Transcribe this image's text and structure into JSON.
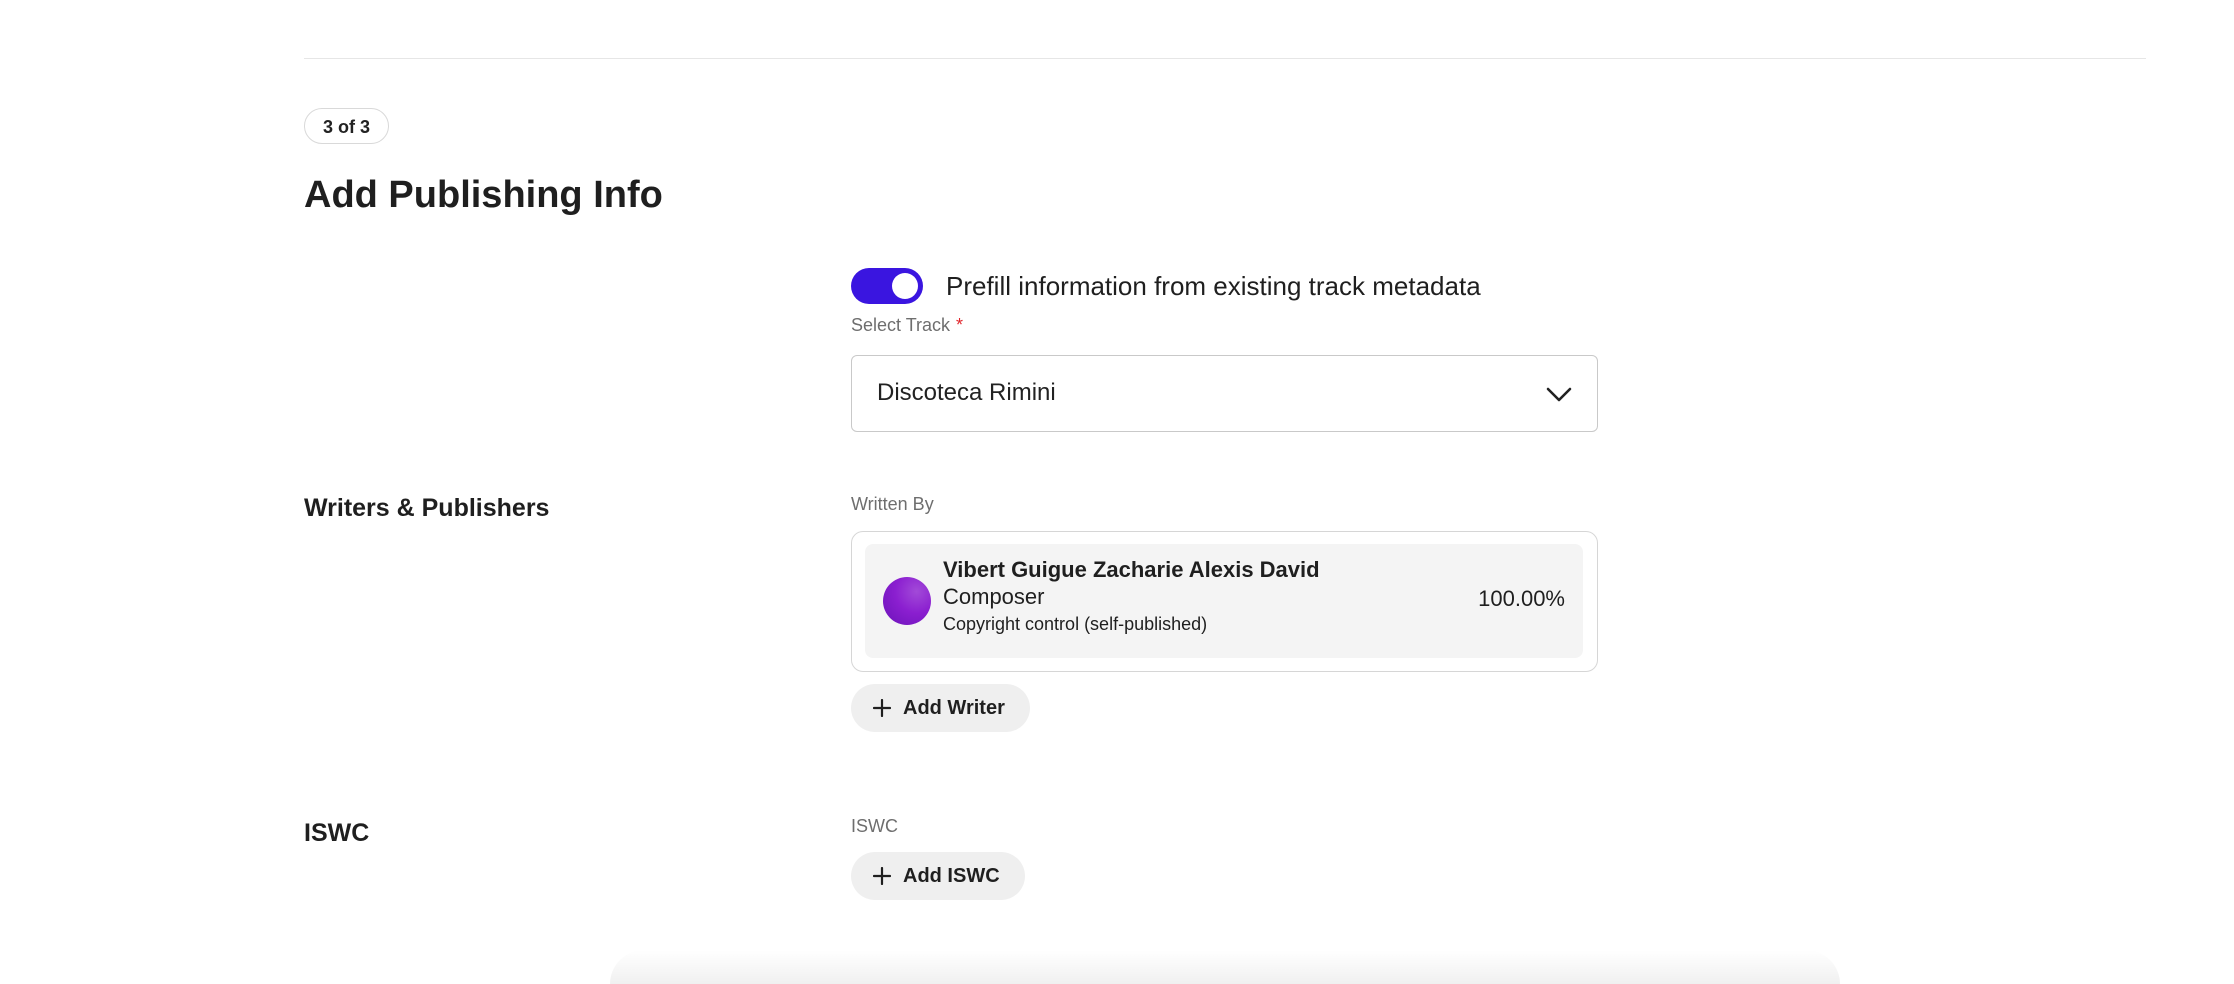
{
  "step_badge": "3 of 3",
  "page_title": "Add Publishing Info",
  "prefill": {
    "enabled": true,
    "label": "Prefill information from existing track metadata"
  },
  "select_track": {
    "label": "Select Track",
    "required_mark": "*",
    "value": "Discoteca Rimini"
  },
  "writers_section": {
    "heading": "Writers & Publishers",
    "written_by_label": "Written By",
    "writers": [
      {
        "name": "Vibert Guigue Zacharie Alexis David",
        "role": "Composer",
        "publisher": "Copyright control (self-published)",
        "share": "100.00%"
      }
    ],
    "add_writer_label": "Add Writer"
  },
  "iswc_section": {
    "heading": "ISWC",
    "field_label": "ISWC",
    "add_iswc_label": "Add ISWC"
  },
  "colors": {
    "accent": "#3a15e0",
    "avatar": "#8b1fd0",
    "required": "#e0262c"
  }
}
